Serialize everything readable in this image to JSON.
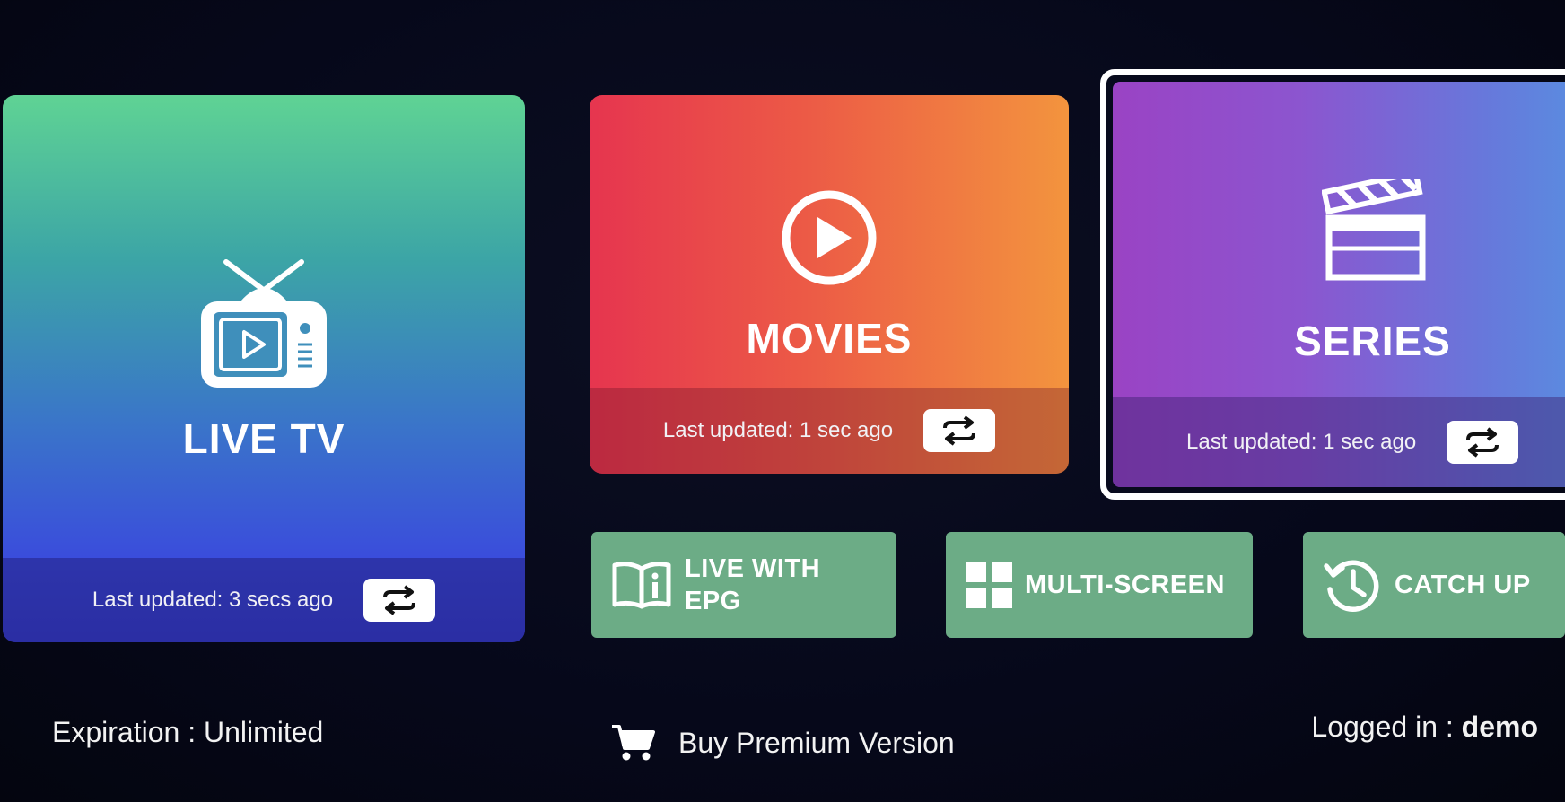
{
  "tiles": {
    "live_tv": {
      "title": "LIVE TV",
      "last_updated": "Last updated: 3 secs ago",
      "icon": "tv-icon",
      "refresh_icon": "refresh-icon"
    },
    "movies": {
      "title": "MOVIES",
      "last_updated": "Last updated: 1 sec ago",
      "icon": "play-circle-icon",
      "refresh_icon": "refresh-icon"
    },
    "series": {
      "title": "SERIES",
      "last_updated": "Last updated: 1 sec ago",
      "icon": "clapperboard-icon",
      "refresh_icon": "refresh-icon",
      "selected": true
    }
  },
  "actions": {
    "live_epg": {
      "line1": "LIVE WITH",
      "line2": "EPG",
      "icon": "book-info-icon"
    },
    "multi_screen": {
      "label": "MULTI-SCREEN",
      "icon": "grid-icon"
    },
    "catch_up": {
      "label": "CATCH UP",
      "icon": "history-icon"
    }
  },
  "footer": {
    "expiration": "Expiration : Unlimited",
    "buy_premium": "Buy Premium Version",
    "logged_in_label": "Logged in : ",
    "logged_in_user": "demo",
    "cart_icon": "cart-icon"
  },
  "colors": {
    "background": "#06081a",
    "action_button": "#6cac86",
    "selected_border": "#ffffff"
  }
}
